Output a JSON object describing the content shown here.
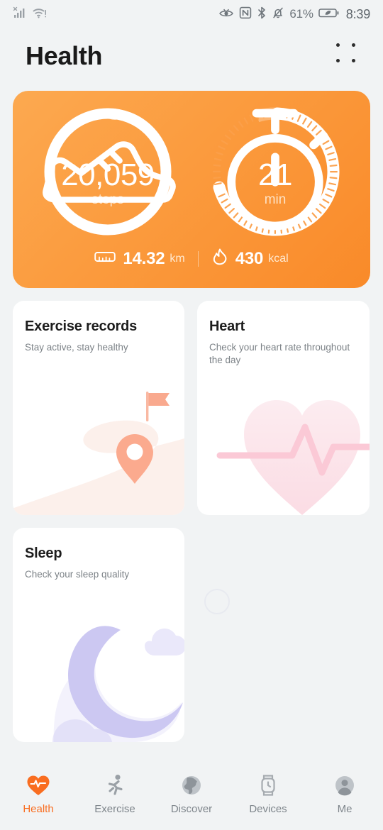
{
  "status_bar": {
    "signal_icon": "signal-bars-no-sim-icon",
    "wifi_icon": "wifi-warning-icon",
    "eye_comfort_icon": "eye-comfort-icon",
    "nfc_icon": "nfc-icon",
    "bluetooth_icon": "bluetooth-icon",
    "silent_icon": "bell-muted-icon",
    "battery_percent": "61%",
    "battery_icon": "battery-charging-icon",
    "clock": "8:39"
  },
  "header": {
    "title": "Health",
    "menu_icon": "grid-dots-menu-icon"
  },
  "summary": {
    "steps": {
      "icon": "running-shoe-icon",
      "value": "20,059",
      "unit": "steps",
      "ring_progress_percent": 100
    },
    "minutes": {
      "icon": "stopwatch-icon",
      "value": "21",
      "unit": "min",
      "ring_progress_percent": 70
    },
    "distance": {
      "icon": "ruler-icon",
      "value": "14.32",
      "unit": "km"
    },
    "calories": {
      "icon": "flame-icon",
      "value": "430",
      "unit": "kcal"
    }
  },
  "cards": [
    {
      "id": "exercise-records",
      "title": "Exercise records",
      "subtitle": "Stay active, stay healthy",
      "art": "route-map-pin-flag-illustration"
    },
    {
      "id": "heart",
      "title": "Heart",
      "subtitle": "Check your heart rate throughout the day",
      "art": "heart-ecg-illustration"
    },
    {
      "id": "sleep",
      "title": "Sleep",
      "subtitle": "Check your sleep quality",
      "art": "crescent-moon-clouds-illustration"
    }
  ],
  "bottom_nav": {
    "items": [
      {
        "label": "Health",
        "icon": "heart-pulse-icon",
        "active": true
      },
      {
        "label": "Exercise",
        "icon": "running-man-icon",
        "active": false
      },
      {
        "label": "Discover",
        "icon": "globe-icon",
        "active": false
      },
      {
        "label": "Devices",
        "icon": "smartwatch-icon",
        "active": false
      },
      {
        "label": "Me",
        "icon": "person-avatar-icon",
        "active": false
      }
    ]
  },
  "colors": {
    "accent_orange": "#F96D20",
    "card_gradient_start": "#FCA950",
    "card_gradient_end": "#F98A29",
    "page_background": "#F1F3F4",
    "card_background": "#FFFFFF",
    "inactive_nav": "#7E858B"
  }
}
